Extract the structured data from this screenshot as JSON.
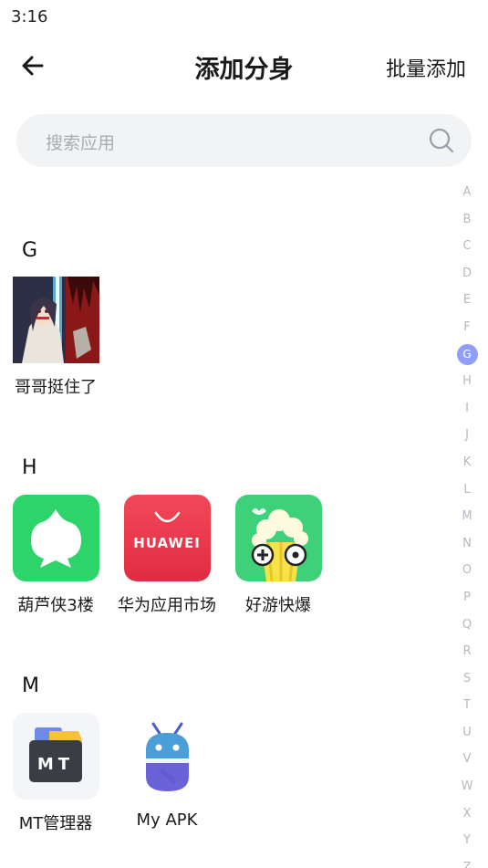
{
  "status_bar": {
    "time": "3:16"
  },
  "header": {
    "title": "添加分身",
    "batch_add": "批量添加"
  },
  "search": {
    "placeholder": "搜索应用"
  },
  "sections": [
    {
      "letter": "G",
      "apps": [
        {
          "name": "哥哥挺住了",
          "icon": "game-character-icon"
        }
      ]
    },
    {
      "letter": "H",
      "apps": [
        {
          "name": "葫芦侠3楼",
          "icon": "gourd-icon"
        },
        {
          "name": "华为应用市场",
          "icon": "huawei-appgallery-icon",
          "brand_text": "HUAWEI"
        },
        {
          "name": "好游快爆",
          "icon": "popcorn-icon"
        }
      ]
    },
    {
      "letter": "M",
      "apps": [
        {
          "name": "MT管理器",
          "icon": "mt-manager-icon",
          "brand_text": "MT"
        },
        {
          "name": "My APK",
          "icon": "android-robot-icon"
        }
      ]
    }
  ],
  "alphabet_index": {
    "letters": [
      "A",
      "B",
      "C",
      "D",
      "E",
      "F",
      "G",
      "H",
      "I",
      "J",
      "K",
      "L",
      "M",
      "N",
      "O",
      "P",
      "Q",
      "R",
      "S",
      "T",
      "U",
      "V",
      "W",
      "X",
      "Y",
      "Z"
    ],
    "active": "G"
  },
  "colors": {
    "accent": "#8f9ff5",
    "huluxia_green": "#2dd46a",
    "huawei_red": "#e8374b",
    "haoyou_green": "#3fd07a"
  }
}
